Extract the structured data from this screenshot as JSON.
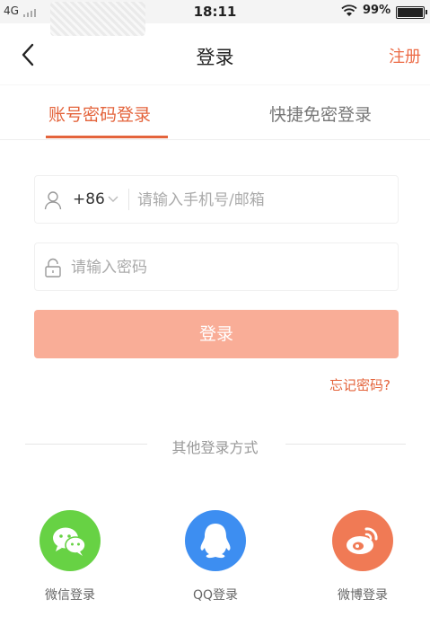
{
  "status_bar": {
    "carrier": "4G",
    "time": "18:11",
    "battery_percent": "99%"
  },
  "header": {
    "title": "登录",
    "register_label": "注册"
  },
  "tabs": [
    {
      "label": "账号密码登录",
      "active": true
    },
    {
      "label": "快捷免密登录",
      "active": false
    }
  ],
  "form": {
    "country_code": "+86",
    "account_placeholder": "请输入手机号/邮箱",
    "password_placeholder": "请输入密码",
    "login_button": "登录",
    "forgot_password": "忘记密码?"
  },
  "other_login": {
    "divider_text": "其他登录方式",
    "options": [
      {
        "label": "微信登录",
        "icon": "wechat-icon",
        "color": "#67d244"
      },
      {
        "label": "QQ登录",
        "icon": "qq-icon",
        "color": "#3d8ef1"
      },
      {
        "label": "微博登录",
        "icon": "weibo-icon",
        "color": "#f07a55"
      }
    ]
  },
  "colors": {
    "accent": "#e4643c",
    "button_disabled": "#f9ad97"
  }
}
